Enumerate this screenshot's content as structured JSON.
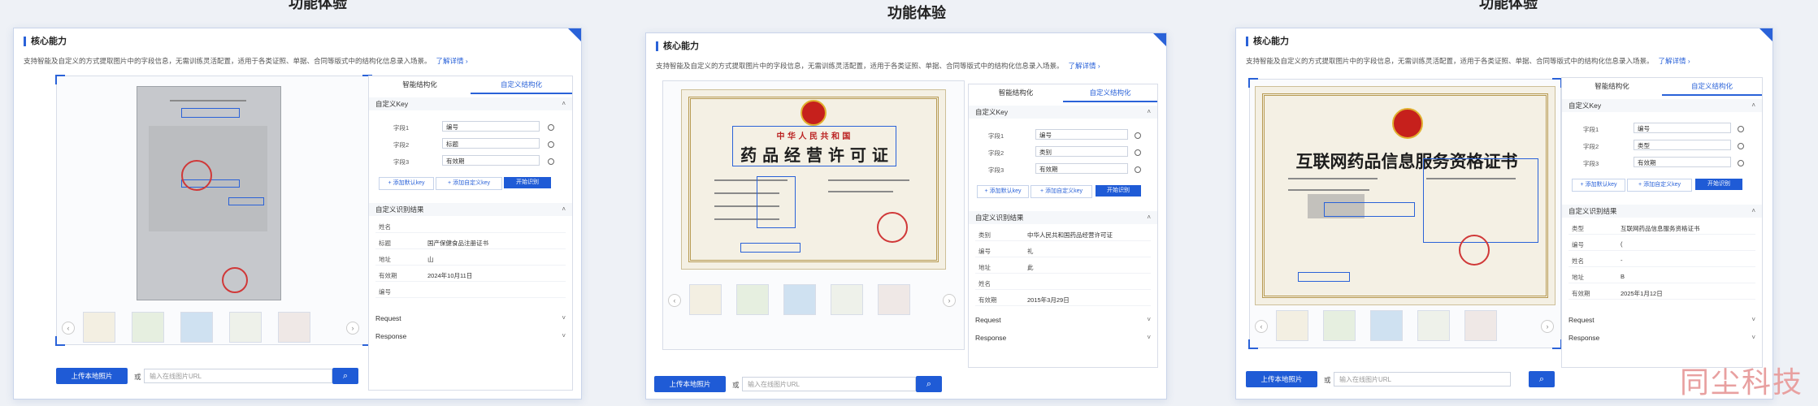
{
  "page": {
    "title": "功能体验",
    "watermark": "同尘科技"
  },
  "panel": {
    "title": "核心能力",
    "desc": "支持智能及自定义的方式提取图片中的字段信息，无需训练灵活配置，适用于各类证照、单据、合同等版式中的结构化信息录入场景。",
    "more": "了解详情 ›",
    "tabs": [
      "智能结构化",
      "自定义结构化"
    ],
    "active_tab": "自定义结构化",
    "custom_key_section": "自定义Key",
    "result_section": "自定义识别结果",
    "request": "Request",
    "response": "Response",
    "add_default": "+ 添加默认key",
    "add_custom": "+ 添加自定义key",
    "run": "开始识别",
    "upload": "上传本地照片",
    "or": "或",
    "url_placeholder": "输入在线图片URL",
    "search_icon": "search-icon",
    "prev_icon": "chevron-left-icon",
    "next_icon": "chevron-right-icon"
  },
  "cards": [
    {
      "fields": [
        {
          "label": "字段1",
          "value": "编号"
        },
        {
          "label": "字段2",
          "value": "标题"
        },
        {
          "label": "字段3",
          "value": "有效期"
        }
      ],
      "results": [
        {
          "k": "姓名",
          "v": ""
        },
        {
          "k": "标题",
          "v": "国产保健食品注册证书"
        },
        {
          "k": "地址",
          "v": "山"
        },
        {
          "k": "有效期",
          "v": "2024年10月11日"
        },
        {
          "k": "编号",
          "v": ""
        }
      ]
    },
    {
      "doc_title_top": "中 华 人 民 共 和 国",
      "doc_title": "药 品 经 营 许 可 证",
      "fields": [
        {
          "label": "字段1",
          "value": "编号"
        },
        {
          "label": "字段2",
          "value": "类别"
        },
        {
          "label": "字段3",
          "value": "有效期"
        }
      ],
      "results": [
        {
          "k": "类别",
          "v": "中华人民共和国药品经营许可证"
        },
        {
          "k": "编号",
          "v": "礼"
        },
        {
          "k": "地址",
          "v": "此"
        },
        {
          "k": "姓名",
          "v": ""
        },
        {
          "k": "有效期",
          "v": "2015年3月29日"
        }
      ]
    },
    {
      "doc_title": "互联网药品信息服务资格证书",
      "fields": [
        {
          "label": "字段1",
          "value": "编号"
        },
        {
          "label": "字段2",
          "value": "类型"
        },
        {
          "label": "字段3",
          "value": "有效期"
        }
      ],
      "results": [
        {
          "k": "类型",
          "v": "互联网药品信息服务资格证书"
        },
        {
          "k": "编号",
          "v": "("
        },
        {
          "k": "姓名",
          "v": "-"
        },
        {
          "k": "地址",
          "v": "B"
        },
        {
          "k": "有效期",
          "v": "2025年1月12日"
        }
      ]
    }
  ]
}
